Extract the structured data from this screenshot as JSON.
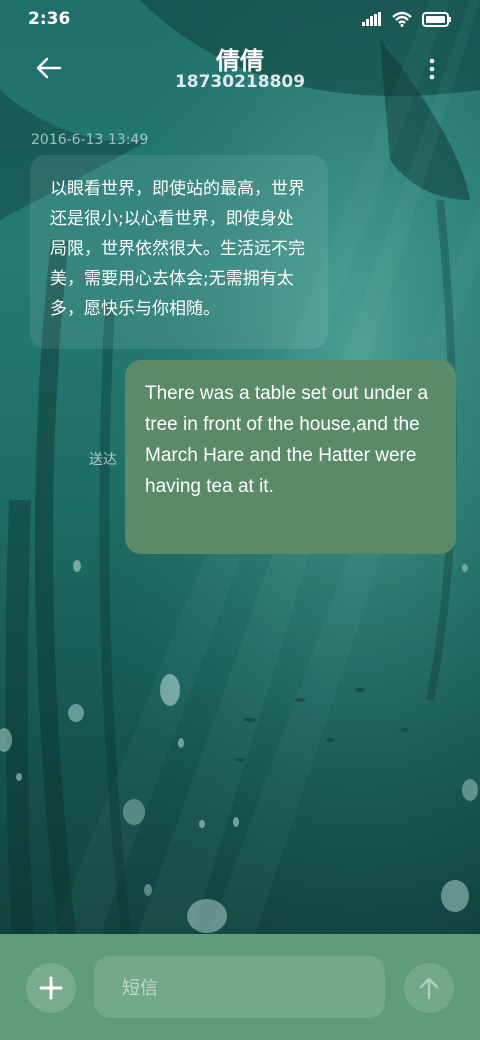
{
  "status_bar": {
    "time": "2:36"
  },
  "header": {
    "contact_name": "倩倩",
    "contact_number": "18730218809"
  },
  "conversation": {
    "timestamp": "2016-6-13 13:49",
    "incoming_text": "以眼看世界，即使站的最高，世界还是很小;以心看世界，即使身处局限，世界依然很大。生活远不完美，需要用心去体会;无需拥有太多，愿快乐与你相随。",
    "outgoing_text": "There was a table set out under a tree in front of the house,and the March Hare and the Hatter were having tea at it.",
    "outgoing_status": "送达"
  },
  "composer": {
    "placeholder": "短信"
  },
  "colors": {
    "composer_bg": "#5f9c78",
    "outgoing_bubble": "#5a8a68",
    "background": "#1f6f6a"
  }
}
